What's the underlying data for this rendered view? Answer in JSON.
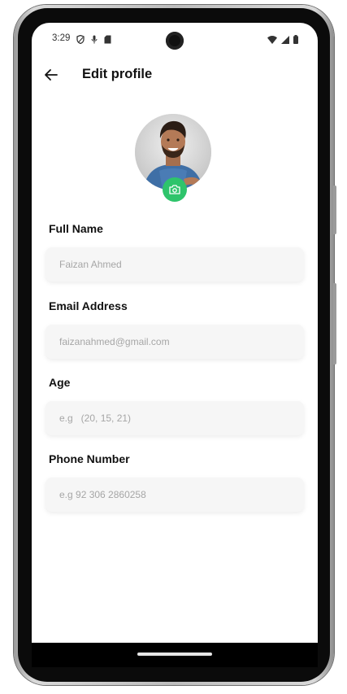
{
  "status_bar": {
    "time": "3:29",
    "left_icons": [
      "shield-icon",
      "mic-icon",
      "sd-card-icon"
    ],
    "right_icons": [
      "wifi-icon",
      "signal-icon",
      "battery-icon"
    ]
  },
  "header": {
    "back_icon": "arrow-left-icon",
    "title": "Edit profile"
  },
  "profile": {
    "camera_icon": "camera-icon",
    "accent_color": "#2ec46b"
  },
  "form": {
    "full_name": {
      "label": "Full Name",
      "value": "",
      "placeholder": "Faizan Ahmed"
    },
    "email": {
      "label": "Email Address",
      "value": "",
      "placeholder": "faizanahmed@gmail.com"
    },
    "age": {
      "label": "Age",
      "value": "",
      "placeholder": "e.g   (20, 15, 21)"
    },
    "phone": {
      "label": "Phone Number",
      "value": "",
      "placeholder": "e.g 92 306 2860258"
    }
  }
}
